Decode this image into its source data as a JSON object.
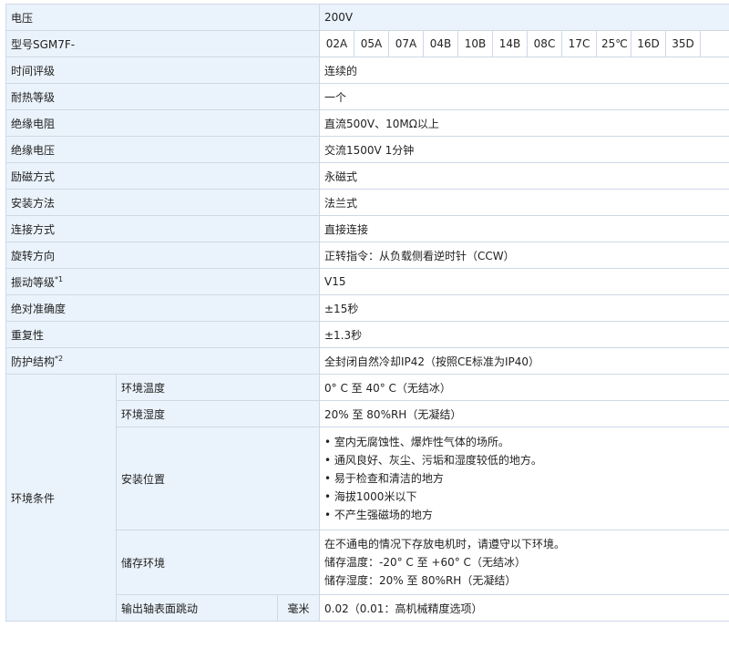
{
  "rows": [
    {
      "label": "电压",
      "value": "200V"
    },
    {
      "label": "型号SGM7F-",
      "models": [
        "02A",
        "05A",
        "07A",
        "04B",
        "10B",
        "14B",
        "08C",
        "17C",
        "25℃",
        "16D",
        "35D"
      ]
    },
    {
      "label": "时间评级",
      "value": "连续的"
    },
    {
      "label": "耐热等级",
      "value": "一个"
    },
    {
      "label": "绝缘电阻",
      "value": "直流500V、10MΩ以上"
    },
    {
      "label": "绝缘电压",
      "value": "交流1500V 1分钟"
    },
    {
      "label": "励磁方式",
      "value": "永磁式"
    },
    {
      "label": "安装方法",
      "value": "法兰式"
    },
    {
      "label": "连接方式",
      "value": "直接连接"
    },
    {
      "label": "旋转方向",
      "value": "正转指令：从负载侧看逆时针（CCW）"
    },
    {
      "label": "振动等级",
      "note": "*1",
      "value": "V15"
    },
    {
      "label": "绝对准确度",
      "value": "±15秒"
    },
    {
      "label": "重复性",
      "value": "±1.3秒"
    },
    {
      "label": "防护结构",
      "note": "*2",
      "value": "全封闭自然冷却IP42（按照CE标准为IP40）"
    }
  ],
  "env": {
    "label": "环境条件",
    "temp": {
      "label": "环境温度",
      "value": "0° C 至 40° C（无结冰）"
    },
    "humidity": {
      "label": "环境湿度",
      "value": "20% 至 80%RH（无凝结）"
    },
    "location": {
      "label": "安装位置",
      "items": [
        "室内无腐蚀性、爆炸性气体的场所。",
        "通风良好、灰尘、污垢和湿度较低的地方。",
        "易于检查和清洁的地方",
        "海拔1000米以下",
        "不产生强磁场的地方"
      ]
    },
    "storage": {
      "label": "储存环境",
      "lines": [
        "在不通电的情况下存放电机时，请遵守以下环境。",
        "储存温度：-20° C 至 +60° C（无结冰）",
        "储存湿度：20% 至 80%RH（无凝结）"
      ]
    }
  },
  "runout": {
    "label": "输出轴表面跳动",
    "unit": "毫米",
    "value": "0.02（0.01：高机械精度选项）"
  }
}
